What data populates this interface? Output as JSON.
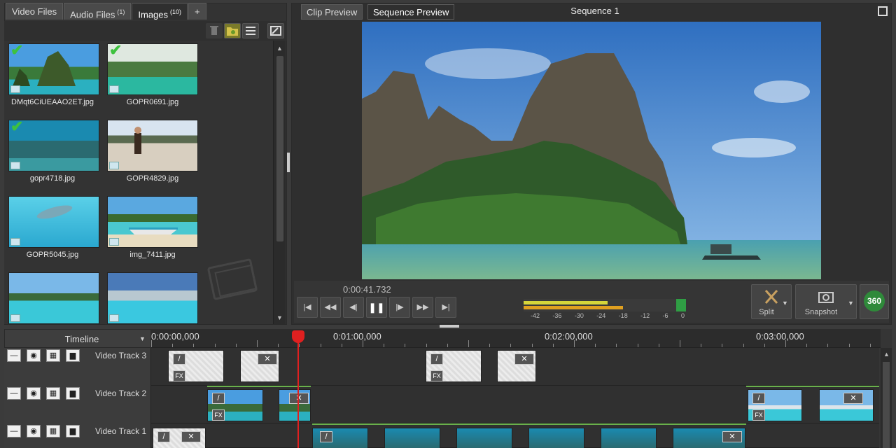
{
  "media_tabs": [
    {
      "label": "Video Files",
      "count": ""
    },
    {
      "label": "Audio Files",
      "count": "(1)"
    },
    {
      "label": "Images",
      "count": "(10)"
    },
    {
      "label": "+",
      "count": ""
    }
  ],
  "media_items": [
    {
      "name": "DMqt6CiUEAAO2ET.jpg",
      "checked": true
    },
    {
      "name": "GOPR0691.jpg",
      "checked": true
    },
    {
      "name": "gopr4718.jpg",
      "checked": true
    },
    {
      "name": "GOPR4829.jpg",
      "checked": false
    },
    {
      "name": "GOPR5045.jpg",
      "checked": false
    },
    {
      "name": "img_7411.jpg",
      "checked": false
    },
    {
      "name": "",
      "checked": false
    },
    {
      "name": "",
      "checked": false
    }
  ],
  "preview": {
    "tab_clip": "Clip Preview",
    "tab_sequence": "Sequence Preview",
    "sequence_title": "Sequence 1",
    "timecode": "0:00:41.732"
  },
  "meter": {
    "scale": [
      "-42",
      "-36",
      "-30",
      "-24",
      "-18",
      "-12",
      "-6",
      "0"
    ],
    "level_top": 0.55,
    "level_bottom": 0.65
  },
  "right_buttons": {
    "split": "Split",
    "snapshot": "Snapshot",
    "vr": "360"
  },
  "timeline": {
    "label": "Timeline",
    "ruler": [
      "0:00:00,000",
      "0:01:00,000",
      "0:02:00,000",
      "0:03:00,000"
    ],
    "tracks": [
      "Video Track 3",
      "Video Track 2",
      "Video Track 1"
    ]
  },
  "glyphs": {
    "check": "✔",
    "fx": "FX",
    "slash": "/",
    "cross": "✕",
    "play_prev": "|◀",
    "frame_prev": "◀◀",
    "step_back": "◀|",
    "pause": "❚❚",
    "step_fwd": "|▶",
    "frame_next": "▶▶",
    "play_next": "▶|"
  },
  "colors": {
    "accent": "#3ec23e",
    "playhead": "#e02020",
    "meter_yellow": "#d6d63a",
    "meter_orange": "#e0a020",
    "meter_green": "#2f9e44"
  }
}
